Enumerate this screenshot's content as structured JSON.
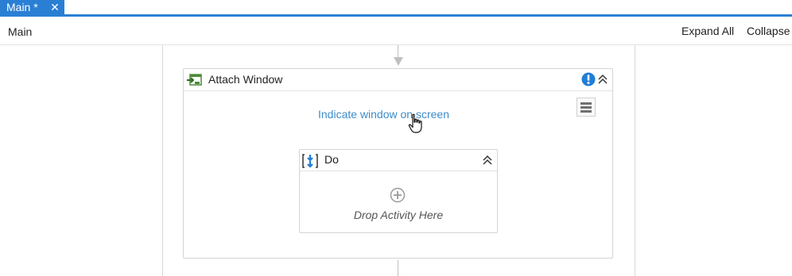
{
  "tab": {
    "title": "Main *",
    "close_glyph": "✕"
  },
  "breadcrumb": {
    "label": "Main"
  },
  "toolbar": {
    "expand_all": "Expand All",
    "collapse_all": "Collapse All"
  },
  "activity": {
    "title": "Attach Window",
    "indicate_link": "Indicate window on screen",
    "icons": [
      "attach-window-icon",
      "warning-icon",
      "collapse-icon",
      "menu-icon"
    ]
  },
  "do_sequence": {
    "title": "Do",
    "drop_hint": "Drop Activity Here",
    "icons": [
      "sequence-icon",
      "collapse-icon",
      "add-icon"
    ]
  },
  "colors": {
    "accent": "#2a7fd4",
    "link": "#3c8ccb",
    "warning": "#1f7ed6"
  }
}
